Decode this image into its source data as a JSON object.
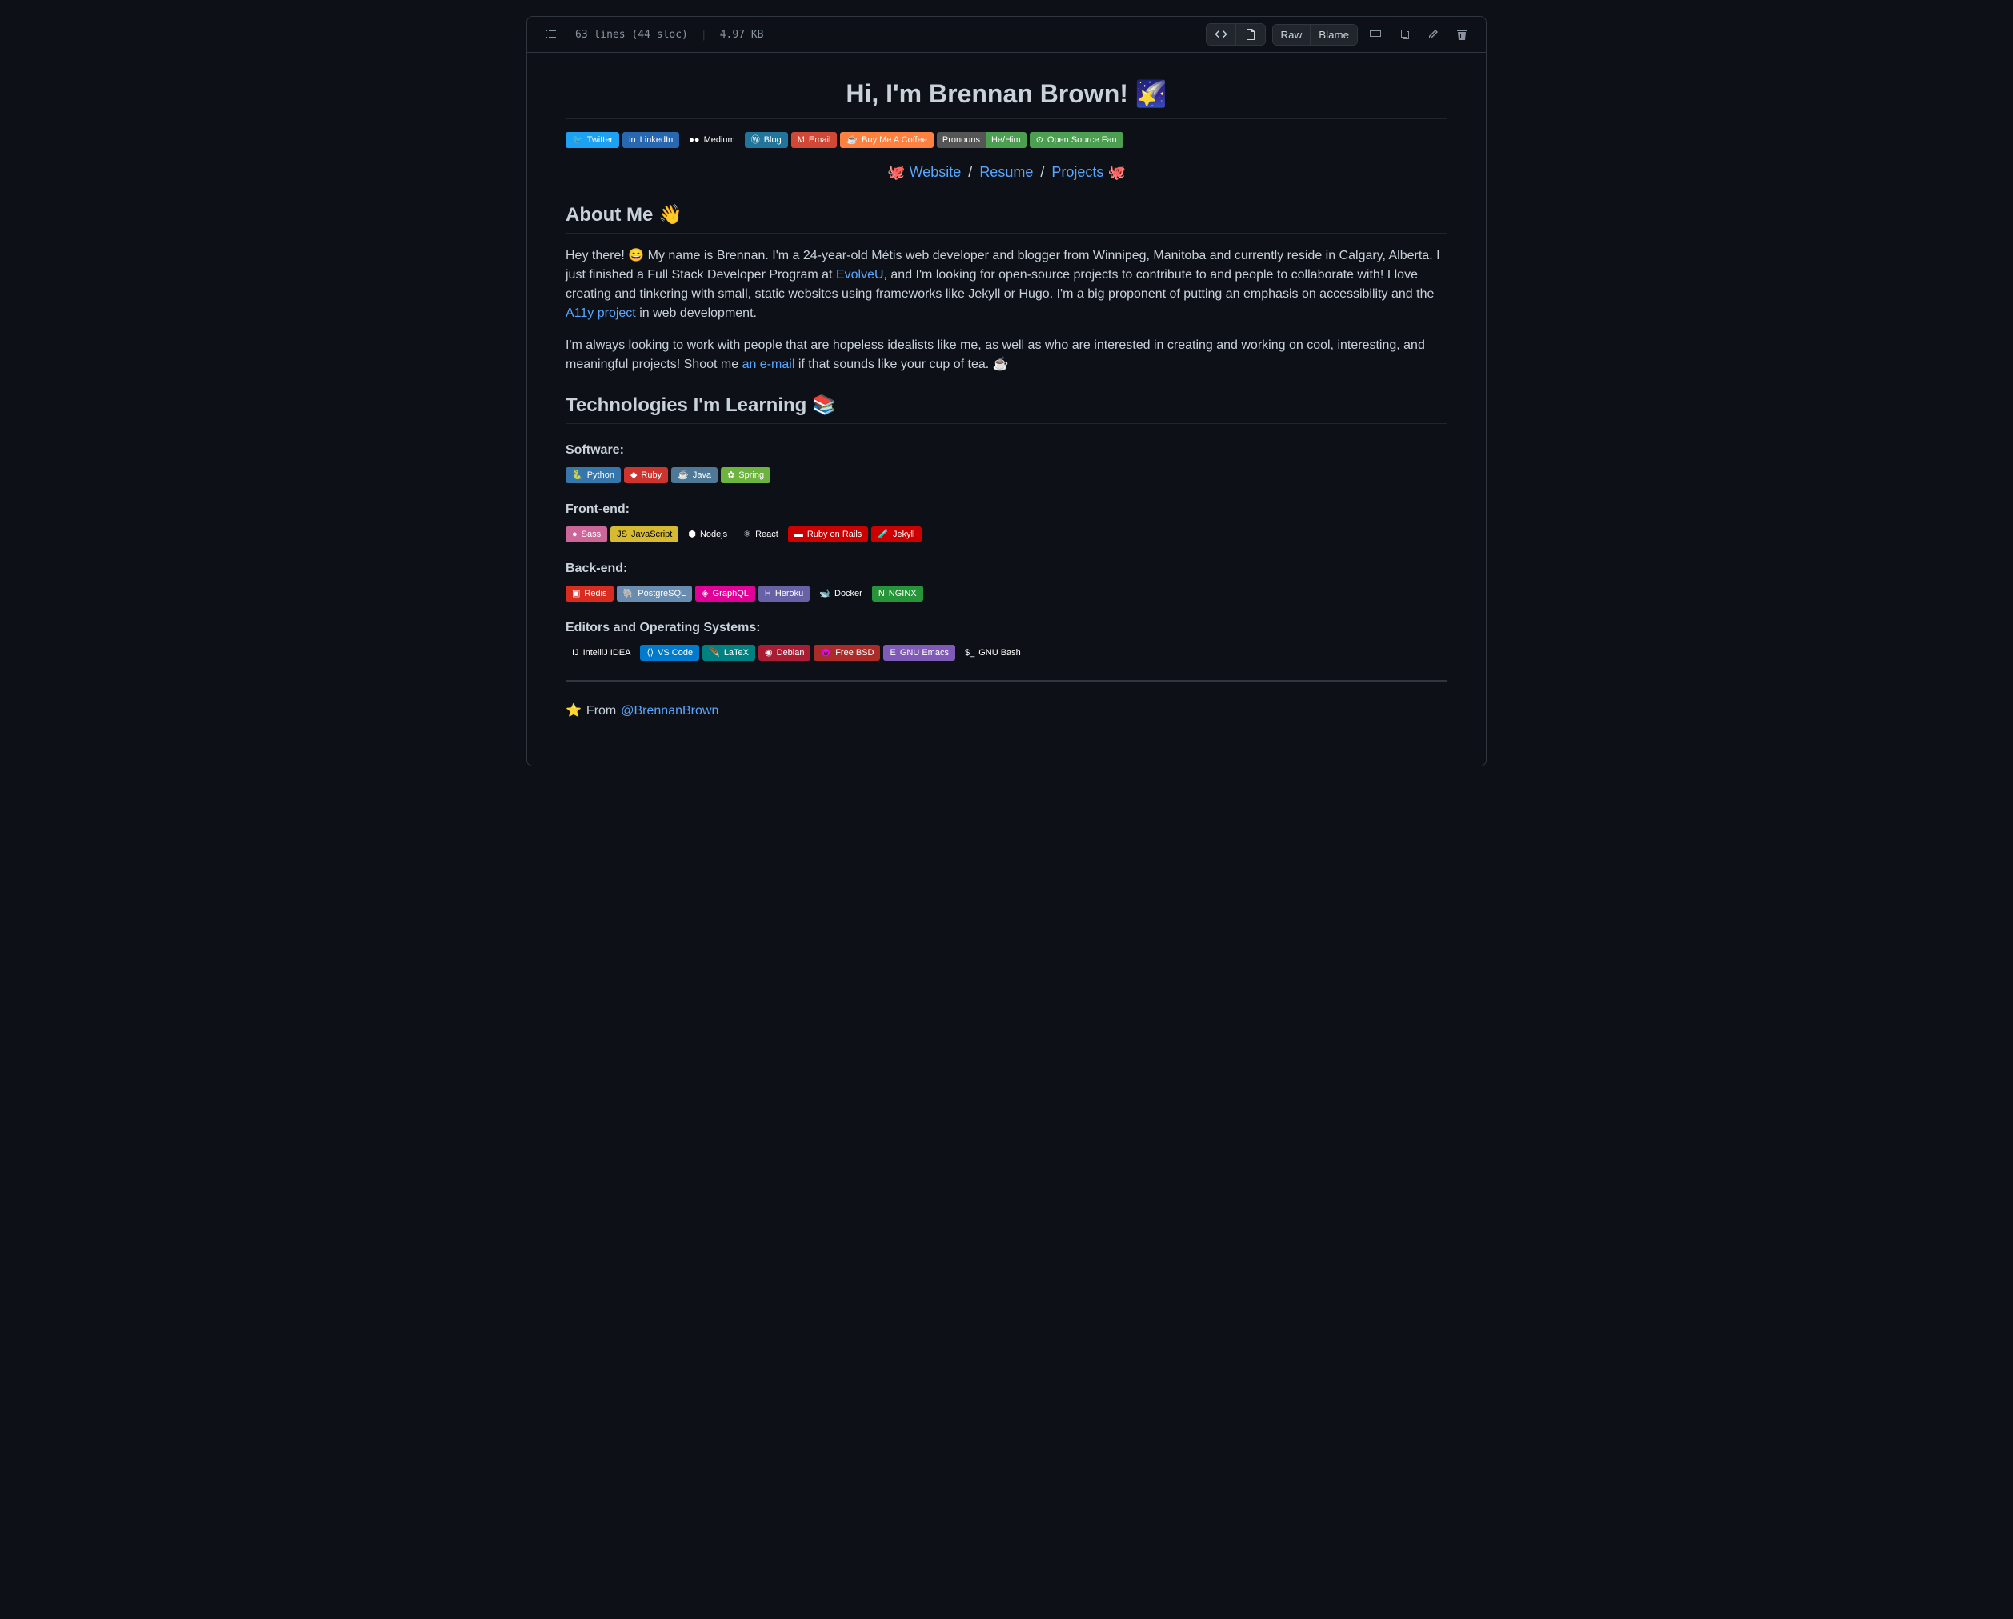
{
  "toolbar": {
    "lines": "63 lines (44 sloc)",
    "size": "4.97 KB",
    "raw": "Raw",
    "blame": "Blame"
  },
  "page": {
    "title": "Hi, I'm Brennan Brown! 🌠"
  },
  "social_badges": [
    {
      "label": "Twitter",
      "bg": "#1DA1F2",
      "icon": "🐦"
    },
    {
      "label": "LinkedIn",
      "bg": "#2867B2",
      "icon": "in"
    },
    {
      "label": "Medium",
      "bg": "#0d1117",
      "icon": "●●"
    },
    {
      "label": "Blog",
      "bg": "#21759B",
      "icon": "Ⓦ"
    },
    {
      "label": "Email",
      "bg": "#D14836",
      "icon": "M"
    },
    {
      "label": "Buy Me A Coffee",
      "bg": "#FF813F",
      "icon": "☕"
    }
  ],
  "split_badges": [
    {
      "left": "Pronouns",
      "left_bg": "#555",
      "right": "He/Him",
      "right_bg": "#4c9e50"
    },
    {
      "left_icon": "⊙",
      "right": "Open Source Fan",
      "bg": "#4c9e50"
    }
  ],
  "nav": {
    "website": "Website",
    "resume": "Resume",
    "projects": "Projects"
  },
  "about": {
    "heading": "About Me 👋",
    "p1a": "Hey there! 😄 My name is Brennan. I'm a 24-year-old Métis web developer and blogger from Winnipeg, Manitoba and currently reside in Calgary, Alberta. I just finished a Full Stack Developer Program at ",
    "link1": "EvolveU",
    "p1b": ", and I'm looking for open-source projects to contribute to and people to collaborate with! I love creating and tinkering with small, static websites using frameworks like Jekyll or Hugo. I'm a big proponent of putting an emphasis on accessibility and the ",
    "link2": "A11y project",
    "p1c": " in web development.",
    "p2a": "I'm always looking to work with people that are hopeless idealists like me, as well as who are interested in creating and working on cool, interesting, and meaningful projects! Shoot me ",
    "link3": "an e-mail",
    "p2b": " if that sounds like your cup of tea. ☕"
  },
  "tech": {
    "heading": "Technologies I'm Learning 📚",
    "software_heading": "Software:",
    "software": [
      {
        "label": "Python",
        "bg": "#3776AB",
        "icon": "🐍"
      },
      {
        "label": "Ruby",
        "bg": "#CC342D",
        "icon": "◆"
      },
      {
        "label": "Java",
        "bg": "#4e7896",
        "icon": "☕"
      },
      {
        "label": "Spring",
        "bg": "#6DB33F",
        "icon": "✿"
      }
    ],
    "frontend_heading": "Front-end:",
    "frontend": [
      {
        "label": "Sass",
        "bg": "#CC6699",
        "icon": "●"
      },
      {
        "label": "JavaScript",
        "bg": "#d6ba32",
        "icon": "JS",
        "text": "#000"
      },
      {
        "label": "Nodejs",
        "bg": "#0d1117",
        "icon": "⬢"
      },
      {
        "label": "React",
        "bg": "#0d1117",
        "icon": "⚛"
      },
      {
        "label": "Ruby on Rails",
        "bg": "#CC0000",
        "icon": "▬"
      },
      {
        "label": "Jekyll",
        "bg": "#CC0000",
        "icon": "🧪"
      }
    ],
    "backend_heading": "Back-end:",
    "backend": [
      {
        "label": "Redis",
        "bg": "#D82C20",
        "icon": "▣"
      },
      {
        "label": "PostgreSQL",
        "bg": "#6a8caf",
        "icon": "🐘"
      },
      {
        "label": "GraphQL",
        "bg": "#E10098",
        "icon": "◈"
      },
      {
        "label": "Heroku",
        "bg": "#6762A6",
        "icon": "H"
      },
      {
        "label": "Docker",
        "bg": "#0d1117",
        "icon": "🐋"
      },
      {
        "label": "NGINX",
        "bg": "#269539",
        "icon": "N"
      }
    ],
    "editors_heading": "Editors and Operating Systems:",
    "editors": [
      {
        "label": "IntelliJ IDEA",
        "bg": "#0d1117",
        "icon": "IJ"
      },
      {
        "label": "VS Code",
        "bg": "#007ACC",
        "icon": "⟨⟩"
      },
      {
        "label": "LaTeX",
        "bg": "#008080",
        "icon": "🪶"
      },
      {
        "label": "Debian",
        "bg": "#A81D33",
        "icon": "◉"
      },
      {
        "label": "Free BSD",
        "bg": "#AB2B28",
        "icon": "😈"
      },
      {
        "label": "GNU Emacs",
        "bg": "#7F5AB6",
        "icon": "E"
      },
      {
        "label": "GNU Bash",
        "bg": "#0d1117",
        "icon": "$_"
      }
    ]
  },
  "footer": {
    "from": "From",
    "handle": "@BrennanBrown"
  }
}
